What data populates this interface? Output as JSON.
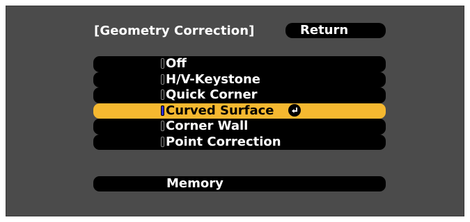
{
  "dialog": {
    "title": "[Geometry Correction]",
    "return_label": "Return"
  },
  "menu": {
    "items": [
      {
        "label": "Off",
        "selected": false
      },
      {
        "label": "H/V-Keystone",
        "selected": false
      },
      {
        "label": "Quick Corner",
        "selected": false
      },
      {
        "label": "Curved Surface",
        "selected": true
      },
      {
        "label": "Corner Wall",
        "selected": false
      },
      {
        "label": "Point Correction",
        "selected": false
      }
    ],
    "memory_label": "Memory"
  },
  "colors": {
    "screen_bg": "#4b4b4b",
    "item_bg": "#000000",
    "highlight": "#f5b830",
    "selected_radio": "#2a2cd8"
  },
  "icons": {
    "enter": "enter-return-icon"
  }
}
